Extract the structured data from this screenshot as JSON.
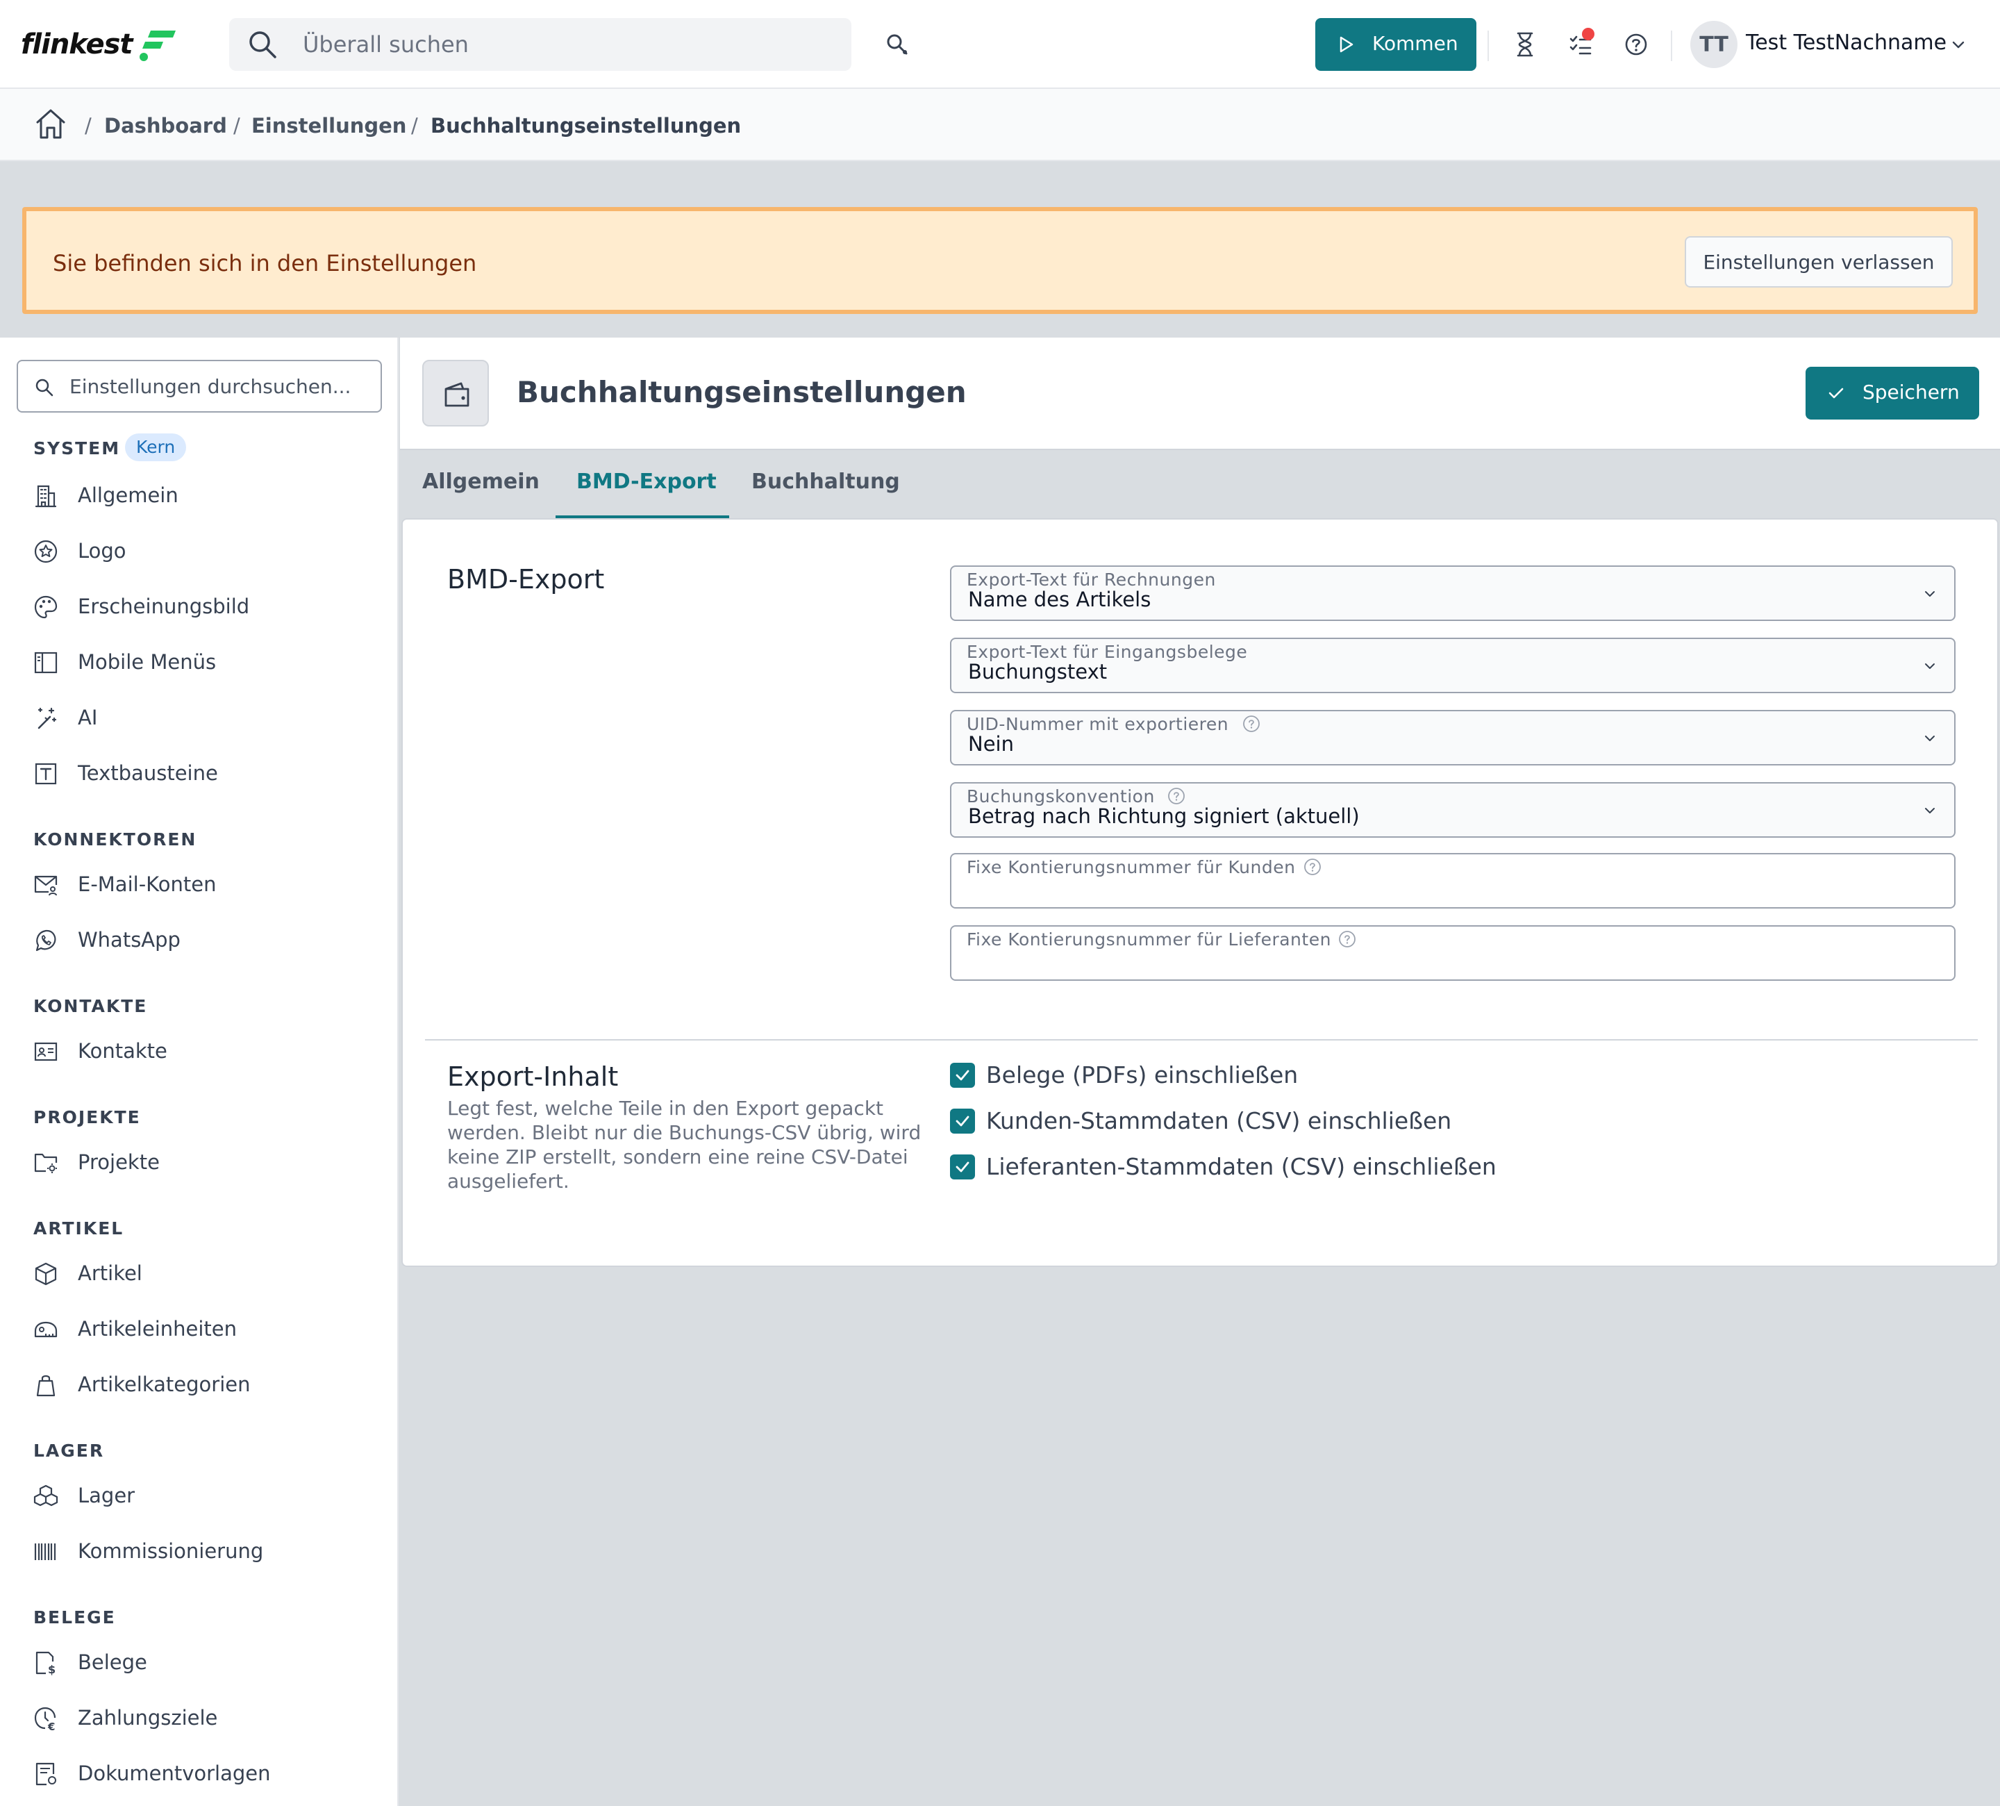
{
  "header": {
    "logo_text": "flinkest",
    "search_placeholder": "Überall suchen",
    "kommen_label": "Kommen",
    "user_initials": "TT",
    "user_name": "Test TestNachname"
  },
  "breadcrumb": {
    "items": [
      "Dashboard",
      "Einstellungen",
      "Buchhaltungseinstellungen"
    ],
    "separator": "/"
  },
  "banner": {
    "message": "Sie befinden sich in den Einstellungen",
    "exit_label": "Einstellungen verlassen"
  },
  "sidebar": {
    "search_placeholder": "Einstellungen durchsuchen...",
    "sections": [
      {
        "title": "SYSTEM",
        "badge": "Kern",
        "items": [
          "Allgemein",
          "Logo",
          "Erscheinungsbild",
          "Mobile Menüs",
          "AI",
          "Textbausteine"
        ]
      },
      {
        "title": "KONNEKTOREN",
        "items": [
          "E-Mail-Konten",
          "WhatsApp"
        ]
      },
      {
        "title": "KONTAKTE",
        "items": [
          "Kontakte"
        ]
      },
      {
        "title": "PROJEKTE",
        "items": [
          "Projekte"
        ]
      },
      {
        "title": "ARTIKEL",
        "items": [
          "Artikel",
          "Artikeleinheiten",
          "Artikelkategorien"
        ]
      },
      {
        "title": "LAGER",
        "items": [
          "Lager",
          "Kommissionierung"
        ]
      },
      {
        "title": "BELEGE",
        "items": [
          "Belege",
          "Zahlungsziele",
          "Dokumentvorlagen"
        ]
      }
    ]
  },
  "page": {
    "title": "Buchhaltungseinstellungen",
    "save_label": "Speichern",
    "tabs": [
      "Allgemein",
      "BMD-Export",
      "Buchhaltung"
    ],
    "active_tab": "BMD-Export"
  },
  "bmd_export": {
    "heading": "BMD-Export",
    "fields": [
      {
        "label": "Export-Text für Rechnungen",
        "value": "Name des Artikels",
        "type": "select"
      },
      {
        "label": "Export-Text für Eingangsbelege",
        "value": "Buchungstext",
        "type": "select"
      },
      {
        "label": "UID-Nummer mit exportieren",
        "value": "Nein",
        "type": "select",
        "help": true
      },
      {
        "label": "Buchungskonvention",
        "value": "Betrag nach Richtung signiert (aktuell)",
        "type": "select",
        "help": true
      },
      {
        "label": "Fixe Kontierungsnummer für Kunden",
        "value": "",
        "type": "input",
        "help": true
      },
      {
        "label": "Fixe Kontierungsnummer für Lieferanten",
        "value": "",
        "type": "input",
        "help": true
      }
    ]
  },
  "export_inhalt": {
    "heading": "Export-Inhalt",
    "description_lines": [
      "Legt fest, welche Teile in den Export gepackt",
      "werden. Bleibt nur die Buchungs-CSV übrig, wird",
      "keine ZIP erstellt, sondern eine reine CSV-Datei",
      "ausgeliefert."
    ],
    "options": [
      {
        "label": "Belege (PDFs) einschließen",
        "checked": true
      },
      {
        "label": "Kunden-Stammdaten (CSV) einschließen",
        "checked": true
      },
      {
        "label": "Lieferanten-Stammdaten (CSV) einschließen",
        "checked": true
      }
    ]
  },
  "colors": {
    "accent": "#107883",
    "banner_bg": "#ffeccf",
    "banner_border": "#f7b56c",
    "notification": "#ef4444"
  }
}
